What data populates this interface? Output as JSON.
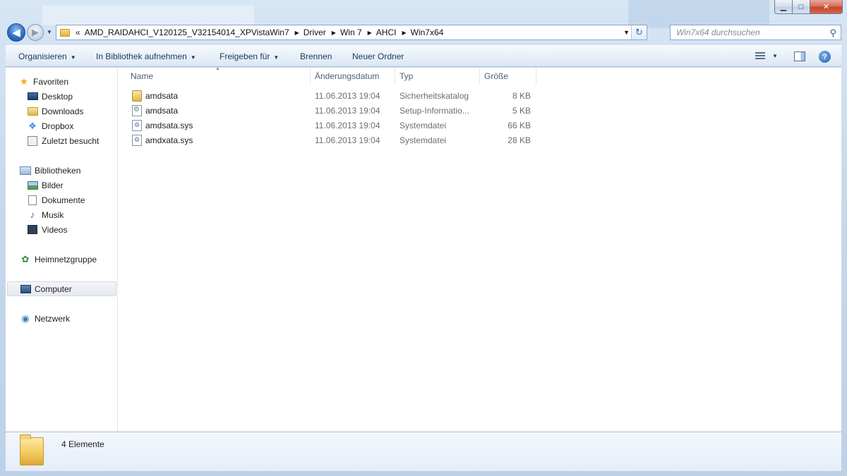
{
  "window": {
    "minimize_glyph": "▁",
    "maximize_glyph": "□",
    "close_glyph": "✕"
  },
  "nav": {
    "back_glyph": "◀",
    "forward_glyph": "▶",
    "history_glyph": "▼",
    "address_chevron": "«",
    "breadcrumb": [
      "AMD_RAIDAHCI_V120125_V32154014_XPVistaWin7",
      "Driver",
      "Win 7",
      "AHCI",
      "Win7x64"
    ],
    "crumb_separator": "▶",
    "dropdown_glyph": "▼",
    "refresh_glyph": "↻",
    "search_placeholder": "Win7x64 durchsuchen",
    "search_glyph": "⚲"
  },
  "toolbar": {
    "organize": "Organisieren",
    "include_library": "In Bibliothek aufnehmen",
    "share": "Freigeben für",
    "burn": "Brennen",
    "new_folder": "Neuer Ordner",
    "caret": "▼",
    "help": "?"
  },
  "sidebar": {
    "items": [
      {
        "label": "Favoriten"
      },
      {
        "label": "Desktop"
      },
      {
        "label": "Downloads"
      },
      {
        "label": "Dropbox"
      },
      {
        "label": "Zuletzt besucht"
      },
      {
        "label": "Bibliotheken"
      },
      {
        "label": "Bilder"
      },
      {
        "label": "Dokumente"
      },
      {
        "label": "Musik"
      },
      {
        "label": "Videos"
      },
      {
        "label": "Heimnetzgruppe"
      },
      {
        "label": "Computer"
      },
      {
        "label": "Netzwerk"
      }
    ],
    "glyphs": {
      "star": "★",
      "music": "♪",
      "home": "✿",
      "net": "◉"
    }
  },
  "columns": {
    "name": "Name",
    "date": "Änderungsdatum",
    "type": "Typ",
    "size": "Größe",
    "sort_glyph": "▲"
  },
  "files": [
    {
      "name": "amdsata",
      "date": "11.06.2013 19:04",
      "type": "Sicherheitskatalog",
      "size": "8 KB",
      "icon": "catalog-icon"
    },
    {
      "name": "amdsata",
      "date": "11.06.2013 19:04",
      "type": "Setup-Informatio...",
      "size": "5 KB",
      "icon": "setup-info-icon"
    },
    {
      "name": "amdsata.sys",
      "date": "11.06.2013 19:04",
      "type": "Systemdatei",
      "size": "66 KB",
      "icon": "system-file-icon"
    },
    {
      "name": "amdxata.sys",
      "date": "11.06.2013 19:04",
      "type": "Systemdatei",
      "size": "28 KB",
      "icon": "system-file-icon"
    }
  ],
  "details": {
    "count": "4 Elemente"
  }
}
